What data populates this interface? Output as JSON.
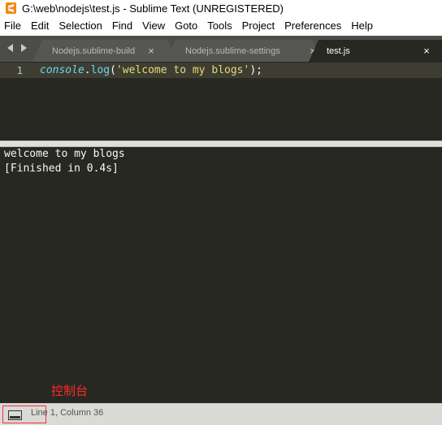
{
  "window": {
    "title": "G:\\web\\nodejs\\test.js - Sublime Text (UNREGISTERED)",
    "app_icon": "sublime-text-icon"
  },
  "menu": [
    "File",
    "Edit",
    "Selection",
    "Find",
    "View",
    "Goto",
    "Tools",
    "Project",
    "Preferences",
    "Help"
  ],
  "tabs": [
    {
      "label": "Nodejs.sublime-build",
      "active": false
    },
    {
      "label": "Nodejs.sublime-settings",
      "active": false
    },
    {
      "label": "test.js",
      "active": true
    }
  ],
  "tab_close_glyph": "×",
  "editor": {
    "line_number": "1",
    "code": {
      "object": "console",
      "dot": ".",
      "method": "log",
      "open": "(",
      "string": "'welcome to my blogs'",
      "close": ");"
    }
  },
  "console_output": [
    "welcome to my blogs",
    "[Finished in 0.4s]"
  ],
  "annotation": "控制台",
  "status": {
    "text": "Line 1, Column 36"
  },
  "colors": {
    "editor_bg": "#272822",
    "tab_bar_bg": "#4b4d48",
    "string": "#e6db74",
    "keyword_blue": "#66d9ef",
    "annotation_red": "#ff2a2a"
  }
}
